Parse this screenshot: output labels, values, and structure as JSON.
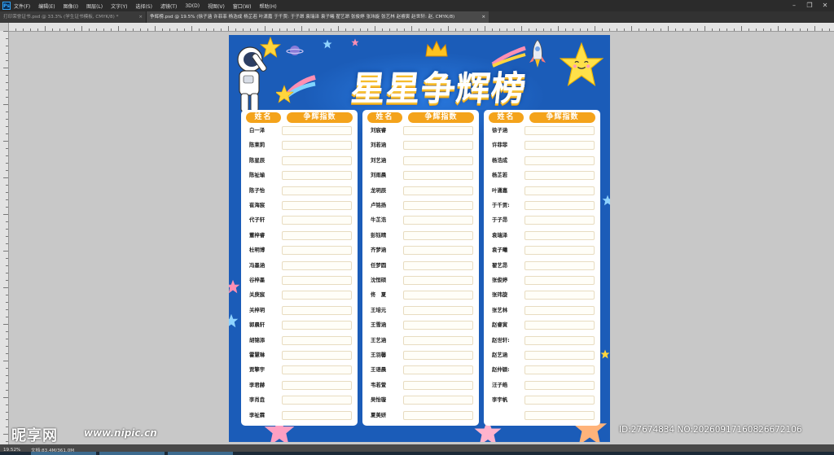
{
  "menubar": {
    "app_icon": "Ps",
    "items": [
      "文件(F)",
      "编辑(E)",
      "图像(I)",
      "图层(L)",
      "文字(Y)",
      "选择(S)",
      "滤镜(T)",
      "3D(D)",
      "视图(V)",
      "窗口(W)",
      "帮助(H)"
    ],
    "controls": [
      "minimize-icon",
      "restore-icon",
      "close-icon"
    ]
  },
  "tabs": [
    {
      "label": "打印荣誉证书.psd @ 33.3% (学生证书模板, CMYK/8) *",
      "close": "×"
    },
    {
      "label": "争辉榜.psd @ 19.5% (徐子涵 许菲菲 杨浩成 杨芷若 叶潇嘉 于千贾: 于子昂 袁瑞泽 袁子曦 翟艺昂 张俊婷 张玮旋 张艺林 赵睿寅 赵世轩: 赵, CMYK/8)",
      "close": "×"
    }
  ],
  "poster": {
    "title": "星星争辉榜",
    "header_name": "姓名",
    "header_index": "争辉指数",
    "columns": [
      [
        "白一泽",
        "陈莱莉",
        "陈星辰",
        "陈祉瑜",
        "陈子怡",
        "崔海宸",
        "代子轩",
        "董梓睿",
        "杜明博",
        "冯墨涵",
        "谷梓墨",
        "关庚宸",
        "关梓玥",
        "郭晨轩",
        "胡锦添",
        "霍慧琳",
        "贾擎宇",
        "李君赫",
        "李肖垚",
        "李祉霖"
      ],
      [
        "刘宸睿",
        "刘若涵",
        "刘艺涵",
        "刘雨晨",
        "龙玥辰",
        "卢铭扬",
        "牛芷浩",
        "彭钰晴",
        "齐梦涵",
        "任梦圆",
        "沈恒硕",
        "佟　夏",
        "王培元",
        "王雪涵",
        "王艺涵",
        "王羽馨",
        "王语晨",
        "韦若萱",
        "吴怡璇",
        "夏美妍"
      ],
      [
        "徐子涵",
        "许菲菲",
        "杨浩成",
        "杨芷若",
        "叶潇嘉",
        "于千贾:",
        "于子昂",
        "袁瑞泽",
        "袁子曦",
        "翟艺昂",
        "张俊婷",
        "张玮旋",
        "张艺林",
        "赵睿寅",
        "赵世轩:",
        "赵艺涵",
        "赵仲颖:",
        "汪子皓",
        "李宇帆",
        ""
      ]
    ]
  },
  "status": {
    "zoom": "19.52%",
    "doc": "文档:83.4M/361.0M"
  },
  "watermark": {
    "site": "昵享网",
    "url": "www.nipic.cn",
    "id": "ID:27674834 NO:20260917160826672106"
  }
}
